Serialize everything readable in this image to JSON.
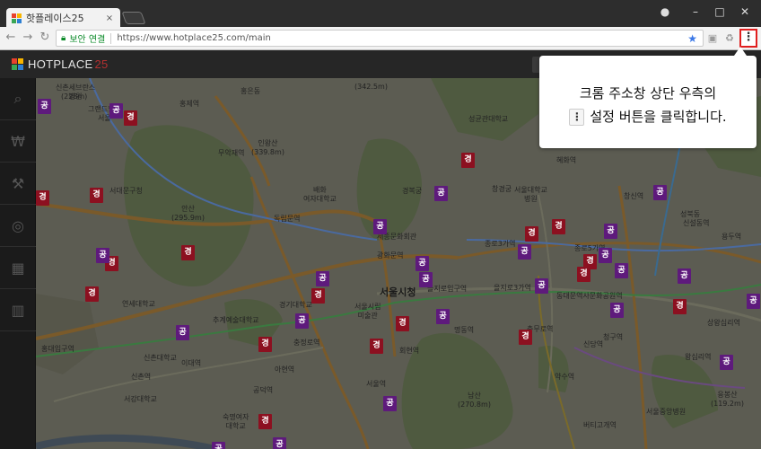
{
  "browser": {
    "tab_title": "핫플레이스25",
    "tab_close": "×",
    "window_controls": {
      "user": "●",
      "minimize": "–",
      "maximize": "□",
      "close": "✕"
    },
    "secure_label": "보안 연결",
    "url": "https://www.hotplace25.com/main",
    "menu_glyph": "⋮"
  },
  "site": {
    "logo_text": "HOTPLACE",
    "logo_number": "25"
  },
  "sidebar": {
    "items": [
      {
        "icon": "search-icon",
        "glyph": "⌕"
      },
      {
        "icon": "money-icon",
        "glyph": "₩"
      },
      {
        "icon": "gavel-icon",
        "glyph": "⚒"
      },
      {
        "icon": "location-icon",
        "glyph": "◎"
      },
      {
        "icon": "grid-icon",
        "glyph": "▦"
      },
      {
        "icon": "chart-icon",
        "glyph": "▥"
      }
    ]
  },
  "callout": {
    "line1": "크롬 주소창 상단 우측의",
    "line2_key": "⋮",
    "line2": "설정 버튼을 클릭합니다."
  },
  "map": {
    "labels": [
      {
        "text": "신촌세브란스\n병원"
      },
      {
        "text": "(342.5m)"
      },
      {
        "text": "홍제역"
      },
      {
        "text": "홍은동"
      },
      {
        "text": "(228m)"
      },
      {
        "text": "그랜드힐튼\n서울"
      },
      {
        "text": "무악재역"
      },
      {
        "text": "인왕산\n(339.8m)"
      },
      {
        "text": "서대문구청"
      },
      {
        "text": "안산\n(295.9m)"
      },
      {
        "text": "독립문역"
      },
      {
        "text": "배화\n여자대학교"
      },
      {
        "text": "경복궁"
      },
      {
        "text": "창경궁"
      },
      {
        "text": "성균관대학교"
      },
      {
        "text": "혜화역"
      },
      {
        "text": "서울대학교\n병원"
      },
      {
        "text": "종로3가역"
      },
      {
        "text": "종로5가역"
      },
      {
        "text": "세종문화회관"
      },
      {
        "text": "광화문역"
      },
      {
        "text": "서울시청",
        "big": true
      },
      {
        "text": "을지로입구역"
      },
      {
        "text": "을지로3가역"
      },
      {
        "text": "동대문역사문화공원역"
      },
      {
        "text": "연세대학교"
      },
      {
        "text": "추계예술대학교"
      },
      {
        "text": "경기대학교"
      },
      {
        "text": "서울시립\n미술관"
      },
      {
        "text": "충정로역"
      },
      {
        "text": "아현역"
      },
      {
        "text": "이대역"
      },
      {
        "text": "신촌역"
      },
      {
        "text": "공덕역"
      },
      {
        "text": "서울역"
      },
      {
        "text": "회현역"
      },
      {
        "text": "명동역"
      },
      {
        "text": "남산\n(270.8m)"
      },
      {
        "text": "충무로역"
      },
      {
        "text": "신당역"
      },
      {
        "text": "청구역"
      },
      {
        "text": "약수역"
      },
      {
        "text": "버티고개역"
      },
      {
        "text": "서강대학교"
      },
      {
        "text": "홍대입구역"
      },
      {
        "text": "신촌대학교"
      },
      {
        "text": "숙명여자\n대학교"
      },
      {
        "text": "상왕십리역"
      },
      {
        "text": "왕십리역"
      },
      {
        "text": "응봉산\n(119.2m)"
      },
      {
        "text": "서울중앙병원"
      },
      {
        "text": "성북동"
      },
      {
        "text": "창신역"
      },
      {
        "text": "신설동역"
      },
      {
        "text": "용두역"
      }
    ],
    "pins": [
      {
        "t": "공"
      },
      {
        "t": "경"
      },
      {
        "t": "공"
      },
      {
        "t": "경"
      },
      {
        "t": "경"
      },
      {
        "t": "경"
      },
      {
        "t": "경"
      },
      {
        "t": "공"
      },
      {
        "t": "공"
      },
      {
        "t": "경"
      },
      {
        "t": "공"
      },
      {
        "t": "공"
      },
      {
        "t": "경"
      },
      {
        "t": "경"
      },
      {
        "t": "공"
      },
      {
        "t": "공"
      },
      {
        "t": "공"
      },
      {
        "t": "경"
      },
      {
        "t": "공"
      },
      {
        "t": "공"
      },
      {
        "t": "경"
      },
      {
        "t": "공"
      },
      {
        "t": "공"
      },
      {
        "t": "경"
      },
      {
        "t": "공"
      },
      {
        "t": "경"
      },
      {
        "t": "경"
      },
      {
        "t": "경"
      },
      {
        "t": "공"
      },
      {
        "t": "공"
      },
      {
        "t": "공"
      },
      {
        "t": "공"
      },
      {
        "t": "경"
      },
      {
        "t": "경"
      },
      {
        "t": "공"
      },
      {
        "t": "공"
      },
      {
        "t": "공"
      },
      {
        "t": "공"
      },
      {
        "t": "경"
      },
      {
        "t": "공"
      },
      {
        "t": "경"
      },
      {
        "t": "공"
      }
    ]
  }
}
